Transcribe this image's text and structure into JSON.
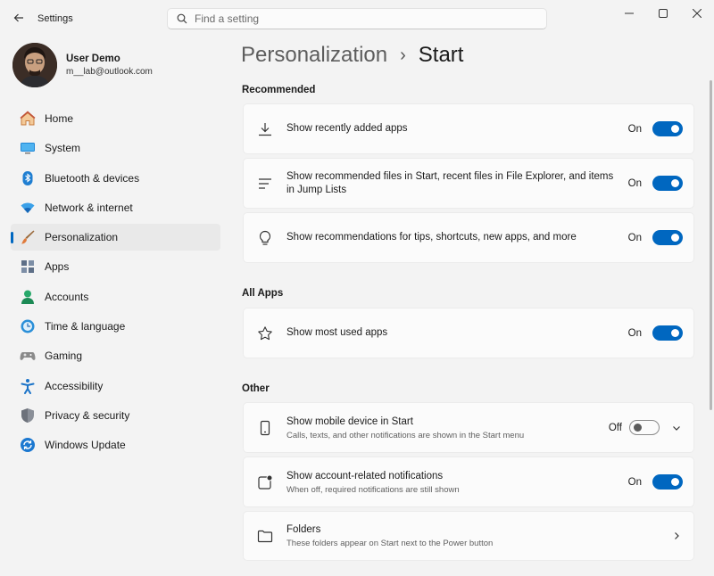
{
  "window": {
    "title": "Settings"
  },
  "search": {
    "placeholder": "Find a setting"
  },
  "profile": {
    "name": "User Demo",
    "email": "m__lab@outlook.com"
  },
  "nav": [
    {
      "label": "Home",
      "icon": "home-icon"
    },
    {
      "label": "System",
      "icon": "system-icon"
    },
    {
      "label": "Bluetooth & devices",
      "icon": "bluetooth-icon"
    },
    {
      "label": "Network & internet",
      "icon": "network-icon"
    },
    {
      "label": "Personalization",
      "icon": "brush-icon",
      "active": true
    },
    {
      "label": "Apps",
      "icon": "apps-icon"
    },
    {
      "label": "Accounts",
      "icon": "accounts-icon"
    },
    {
      "label": "Time & language",
      "icon": "time-language-icon"
    },
    {
      "label": "Gaming",
      "icon": "gaming-icon"
    },
    {
      "label": "Accessibility",
      "icon": "accessibility-icon"
    },
    {
      "label": "Privacy & security",
      "icon": "shield-icon"
    },
    {
      "label": "Windows Update",
      "icon": "update-icon"
    }
  ],
  "breadcrumb": {
    "parent": "Personalization",
    "separator": "›",
    "current": "Start"
  },
  "sections": {
    "recommended": "Recommended",
    "all_apps": "All Apps",
    "other": "Other"
  },
  "settings": {
    "recently_added": {
      "title": "Show recently added apps",
      "state": "On"
    },
    "recommended_files": {
      "title_line1": "Show recommended files in Start, recent files in File Explorer, and items",
      "title_line2": "in Jump Lists",
      "state": "On"
    },
    "tips": {
      "title": "Show recommendations for tips, shortcuts, new apps, and more",
      "state": "On"
    },
    "most_used": {
      "title": "Show most used apps",
      "state": "On"
    },
    "mobile_device": {
      "title": "Show mobile device in Start",
      "desc": "Calls, texts, and other notifications are shown in the Start menu",
      "state": "Off"
    },
    "account_notifications": {
      "title": "Show account-related notifications",
      "desc": "When off, required notifications are still shown",
      "state": "On"
    },
    "folders": {
      "title": "Folders",
      "desc": "These folders appear on Start next to the Power button"
    }
  },
  "colors": {
    "accent": "#0067c0",
    "background": "#f3f3f3",
    "card": "#fbfbfb"
  }
}
